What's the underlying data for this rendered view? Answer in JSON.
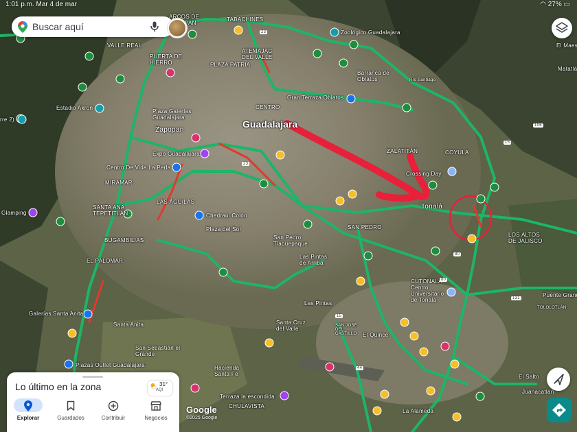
{
  "status_bar": {
    "time": "1:01 p.m.",
    "date": "Mar 4 de mar",
    "battery": "27%"
  },
  "search": {
    "placeholder": "Buscar aquí"
  },
  "map_labels": [
    {
      "text": "Guadalajara",
      "size": "big"
    },
    {
      "text": "Zapopan",
      "size": "mid"
    },
    {
      "text": "Tonalá",
      "size": "mid"
    },
    {
      "text": "TABACHINES"
    },
    {
      "text": "ARCOS DE ZAPOPAN"
    },
    {
      "text": "VALLE REAL"
    },
    {
      "text": "PUERTA DE HIERRO"
    },
    {
      "text": "ATEMAJAC DEL VALLE"
    },
    {
      "text": "PLAZA PATRIA"
    },
    {
      "text": "Zoológico Guadalajara"
    },
    {
      "text": "Barranca de Oblatos"
    },
    {
      "text": "Gran Terraza Oblatos"
    },
    {
      "text": "CENTRO"
    },
    {
      "text": "Estadio Akron"
    },
    {
      "text": "Plaza Galerías Guadalajara"
    },
    {
      "text": "Expo Guadalajara"
    },
    {
      "text": "ZALATITÁN"
    },
    {
      "text": "COYULA"
    },
    {
      "text": "Centro De Vida La Perla"
    },
    {
      "text": "MIRAMAR"
    },
    {
      "text": "LAS ÁGUILAS"
    },
    {
      "text": "SANTA ANA TEPETITLÁN"
    },
    {
      "text": "Glamping"
    },
    {
      "text": "Chedraui Colón"
    },
    {
      "text": "BUGAMBILIAS"
    },
    {
      "text": "Plaza del Sol"
    },
    {
      "text": "SAN PEDRO"
    },
    {
      "text": "San Pedro Tlaquepaque"
    },
    {
      "text": "EL PALOMAR"
    },
    {
      "text": "LOS ALTOS DE JALISCO"
    },
    {
      "text": "Las Pintas de Arriba"
    },
    {
      "text": "CUTONALÁ Centro Universitario de Tonalá"
    },
    {
      "text": "Galerías Santa Anita"
    },
    {
      "text": "Santa Anita"
    },
    {
      "text": "Las Pintas"
    },
    {
      "text": "Santa Cruz del Valle"
    },
    {
      "text": "SAN JOSÉ DEL CASTILLO"
    },
    {
      "text": "El Quince"
    },
    {
      "text": "San Sebastián el Grande"
    },
    {
      "text": "Plazas Outlet Guadalajara"
    },
    {
      "text": "Hacienda Santa Fe"
    },
    {
      "text": "Terraza la escondida"
    },
    {
      "text": "CHULAVISTA"
    },
    {
      "text": "La Alameda"
    },
    {
      "text": "El Salto"
    },
    {
      "text": "Juanacatlán"
    },
    {
      "text": "Puente Grande"
    },
    {
      "text": "TOLOLOTLÁN"
    },
    {
      "text": "El Maes"
    },
    {
      "text": "Matatlá"
    },
    {
      "text": "rre 2)"
    },
    {
      "text": "Crossing Day"
    },
    {
      "text": "Río Santiago"
    }
  ],
  "road_shields": [
    "23",
    "80",
    "80",
    "131",
    "15",
    "44",
    "106",
    "15",
    "23"
  ],
  "weather": {
    "temp": "31°",
    "aqi": "AQI"
  },
  "bottom_sheet": {
    "title": "Lo último en la zona",
    "tabs": [
      {
        "label": "Explorar",
        "icon": "pin-icon",
        "active": true
      },
      {
        "label": "Guardados",
        "icon": "bookmark-icon",
        "active": false
      },
      {
        "label": "Contribuir",
        "icon": "add-circle-icon",
        "active": false
      },
      {
        "label": "Negocios",
        "icon": "store-icon",
        "active": false
      }
    ]
  },
  "attribution": {
    "brand": "Google",
    "copyright": "©2025 Google"
  },
  "colors": {
    "traffic_green": "#1db567",
    "traffic_red": "#e03a2b",
    "annotation_red": "#e8203a",
    "teal_button": "#0b8a8a"
  }
}
